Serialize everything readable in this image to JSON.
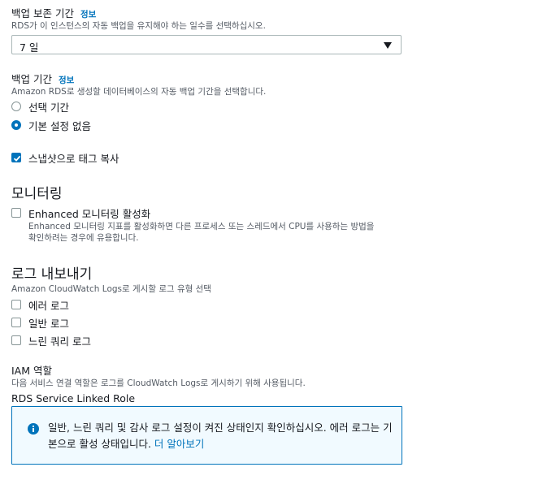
{
  "backup_retention": {
    "label": "백업 보존 기간",
    "info": "정보",
    "description": "RDS가 이 인스턴스의 자동 백업을 유지해야 하는 일수를 선택하십시오.",
    "selected": "7 일"
  },
  "backup_window": {
    "label": "백업 기간",
    "info": "정보",
    "description": "Amazon RDS로 생성할 데이터베이스의 자동 백업 기간을 선택합니다.",
    "options": [
      {
        "label": "선택 기간",
        "selected": false
      },
      {
        "label": "기본 설정 없음",
        "selected": true
      }
    ]
  },
  "copy_tags": {
    "label": "스냅샷으로 태그 복사",
    "checked": true
  },
  "monitoring": {
    "heading": "모니터링",
    "enhanced_label": "Enhanced 모니터링 활성화",
    "enhanced_checked": false,
    "enhanced_desc_1": "Enhanced 모니터링 지표를 활성화하면 다른 프로세스 또는 스레드에서 CPU를 사용하는 방법을",
    "enhanced_desc_2": "확인하려는 경우에 유용합니다."
  },
  "log_exports": {
    "heading": "로그 내보내기",
    "description": "Amazon CloudWatch Logs로 게시할 로그 유형 선택",
    "options": [
      {
        "label": "에러 로그",
        "checked": false
      },
      {
        "label": "일반 로그",
        "checked": false
      },
      {
        "label": "느린 쿼리 로그",
        "checked": false
      }
    ]
  },
  "iam_role": {
    "label": "IAM 역할",
    "description": "다음 서비스 연결 역할은 로그를 CloudWatch Logs로 게시하기 위해 사용됩니다.",
    "value": "RDS Service Linked Role"
  },
  "alert": {
    "icon": "info-icon",
    "message": "일반, 느린 쿼리 및 감사 로그 설정이 켜진 상태인지 확인하십시오. 에러 로그는 기본으로 활성 상태입니다.",
    "link": "더 알아보기"
  },
  "colors": {
    "accent": "#0073bb",
    "alert_bg": "#f1faff",
    "text": "#16191f",
    "muted": "#545b64"
  }
}
